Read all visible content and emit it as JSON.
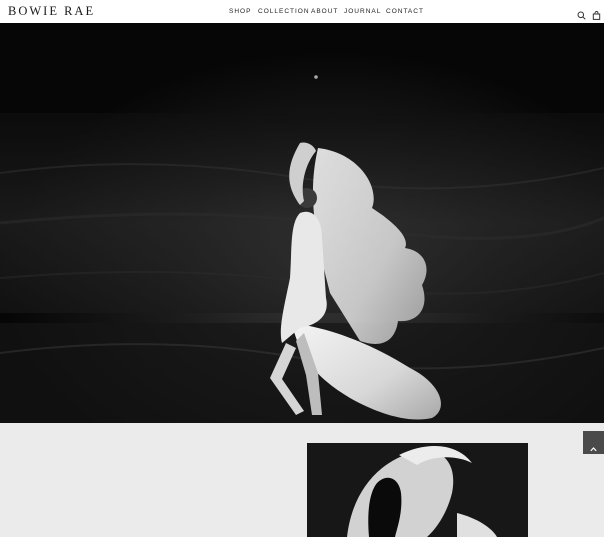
{
  "header": {
    "logo": "BOWIE RAE",
    "nav": [
      "SHOP",
      "COLLECTION",
      "ABOUT",
      "JOURNAL",
      "CONTACT"
    ],
    "icons": [
      "search-icon",
      "bag-icon"
    ]
  },
  "hero": {
    "description_icon": "hero-photo"
  },
  "scroll_top": {
    "icon": "chevron-up-icon"
  },
  "colors": {
    "header_bg": "#ffffff",
    "page_bg": "#ebebeb",
    "hero_bg": "#0c0c0c",
    "button_bg": "#4a4a4a"
  }
}
